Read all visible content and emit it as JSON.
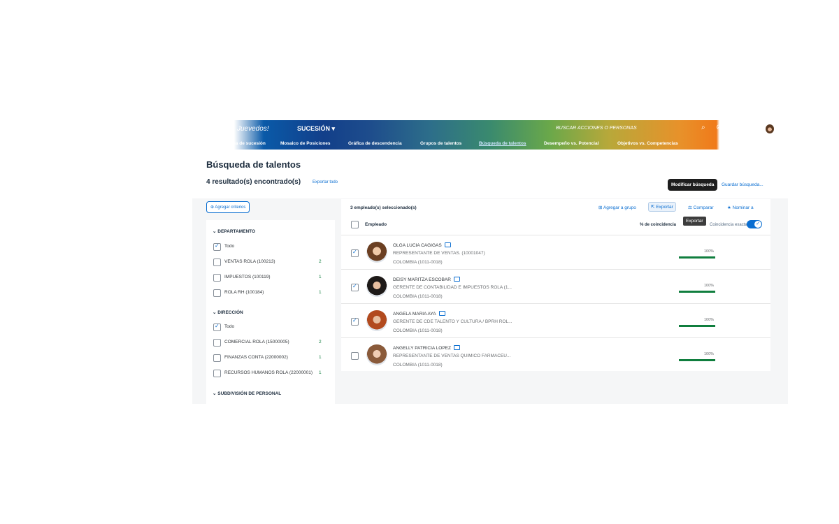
{
  "shell": {
    "logo": "Juevedos!",
    "module": "SUCESIÓN ▾",
    "search_placeholder": "BUSCAR ACCIONES O PERSONAS",
    "icons": [
      "search-icon",
      "help-icon",
      "notifications-icon",
      "avatar"
    ]
  },
  "nav": {
    "tabs": [
      {
        "label": "Organigrama de sucesión",
        "active": false
      },
      {
        "label": "Mosaico de Posiciones",
        "active": false
      },
      {
        "label": "Gráfica de descendencia",
        "active": false
      },
      {
        "label": "Grupos de talentos",
        "active": false
      },
      {
        "label": "Búsqueda de talentos",
        "active": true
      },
      {
        "label": "Desempeño vs. Potencial",
        "active": false
      },
      {
        "label": "Objetivos vs. Competencias",
        "active": false
      }
    ]
  },
  "page": {
    "title": "Búsqueda de talentos",
    "results_count": "4  resultado(s) encontrado(s)",
    "export_all": "Exportar todo",
    "modify_search": "Modificar búsqueda",
    "save_search": "Guardar búsqueda..."
  },
  "filters": {
    "add_criteria": "Agregar criterios",
    "sections": [
      {
        "title": "DEPARTAMENTO",
        "items": [
          {
            "label": "Todo",
            "count": "",
            "checked": true
          },
          {
            "label": "VENTAS ROLA (100213)",
            "count": "2",
            "checked": false
          },
          {
            "label": "IMPUESTOS (100119)",
            "count": "1",
            "checked": false
          },
          {
            "label": "ROLA RH (100184)",
            "count": "1",
            "checked": false
          }
        ]
      },
      {
        "title": "DIRECCIÓN",
        "items": [
          {
            "label": "Todo",
            "count": "",
            "checked": true
          },
          {
            "label": "COMERCIAL ROLA (15000005)",
            "count": "2",
            "checked": false
          },
          {
            "label": "FINANZAS CONTA (22000002)",
            "count": "1",
            "checked": false
          },
          {
            "label": "RECURSOS HUMANOS ROLA (22000001)",
            "count": "1",
            "checked": false
          }
        ]
      },
      {
        "title": "SUBDIVISIÓN DE PERSONAL",
        "items": []
      }
    ]
  },
  "results": {
    "selected_count": "3 empleado(s) seleccionado(s)",
    "toolbar": {
      "add_to_group": "Agregar a grupo",
      "export": "Exportar",
      "compare": "Comparar",
      "nominate": "Nominar a"
    },
    "tooltip": "Exportar",
    "column_employee": "Empleado",
    "column_match": "% de coincidencia",
    "exact_match_label": "Coincidencia exacta",
    "rows": [
      {
        "name": "OLGA LUCIA CAGIGAS",
        "title": "REPRESENTANTE DE VENTAS. (10001047)",
        "location": "COLOMBIA (1011-0018)",
        "match": "100%",
        "match_value": 100,
        "checked": true
      },
      {
        "name": "DEISY MARITZA ESCOBAR",
        "title": "GERENTE DE CONTABILIDAD E IMPUESTOS ROLA (1...",
        "location": "COLOMBIA (1011-0018)",
        "match": "100%",
        "match_value": 100,
        "checked": true
      },
      {
        "name": "ANGELA MARIA AYA",
        "title": "GERENTE DE CDE TALENTO Y CULTURA / BPRH ROL...",
        "location": "COLOMBIA (1011-0018)",
        "match": "100%",
        "match_value": 100,
        "checked": true
      },
      {
        "name": "ANGELLY PATRICIA LOPEZ",
        "title": "REPRESENTANTE DE VENTAS QUIMICO FARMACEU...",
        "location": "COLOMBIA (1011-0018)",
        "match": "100%",
        "match_value": 100,
        "checked": false
      }
    ]
  }
}
